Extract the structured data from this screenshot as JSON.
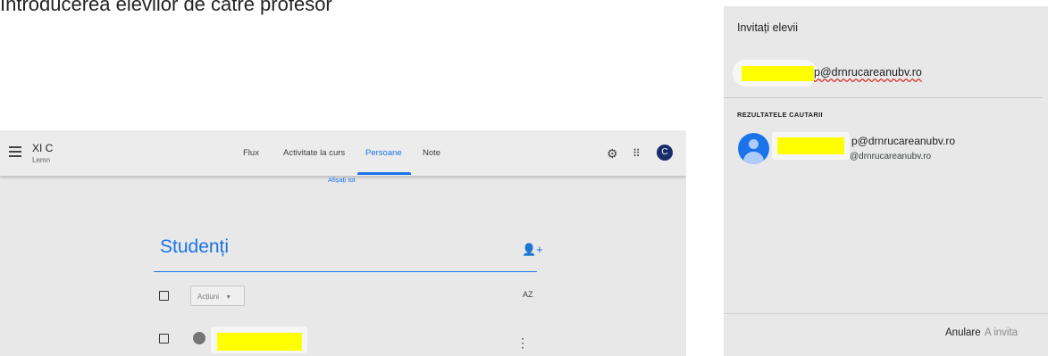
{
  "caption": "Introducerea elevilor de către profesor",
  "classroom": {
    "class_name": "XI C",
    "class_subtitle": "Lemn",
    "tabs": [
      "Flux",
      "Activitate la curs",
      "Persoane",
      "Note"
    ],
    "active_tab": "Persoane",
    "avatar_letter": "C",
    "show_all": "Afișați tot",
    "section_title": "Studenți",
    "actions_dropdown": "Acțiuni",
    "sort_label": "AZ"
  },
  "dialog": {
    "title": "Invitați elevii",
    "chip_email_suffix": "p@drnrucareanubv.ro",
    "results_label": "REZULTATELE CAUTARII",
    "result_email_primary": "p@drnrucareanubv.ro",
    "result_email_secondary": "@drnrucareanubv.ro",
    "cancel_label": "Anulare",
    "invite_label": "A invita"
  },
  "colors": {
    "accent": "#1a73e8",
    "redaction": "#ffff00",
    "avatar_dark": "#1a2d6b"
  }
}
